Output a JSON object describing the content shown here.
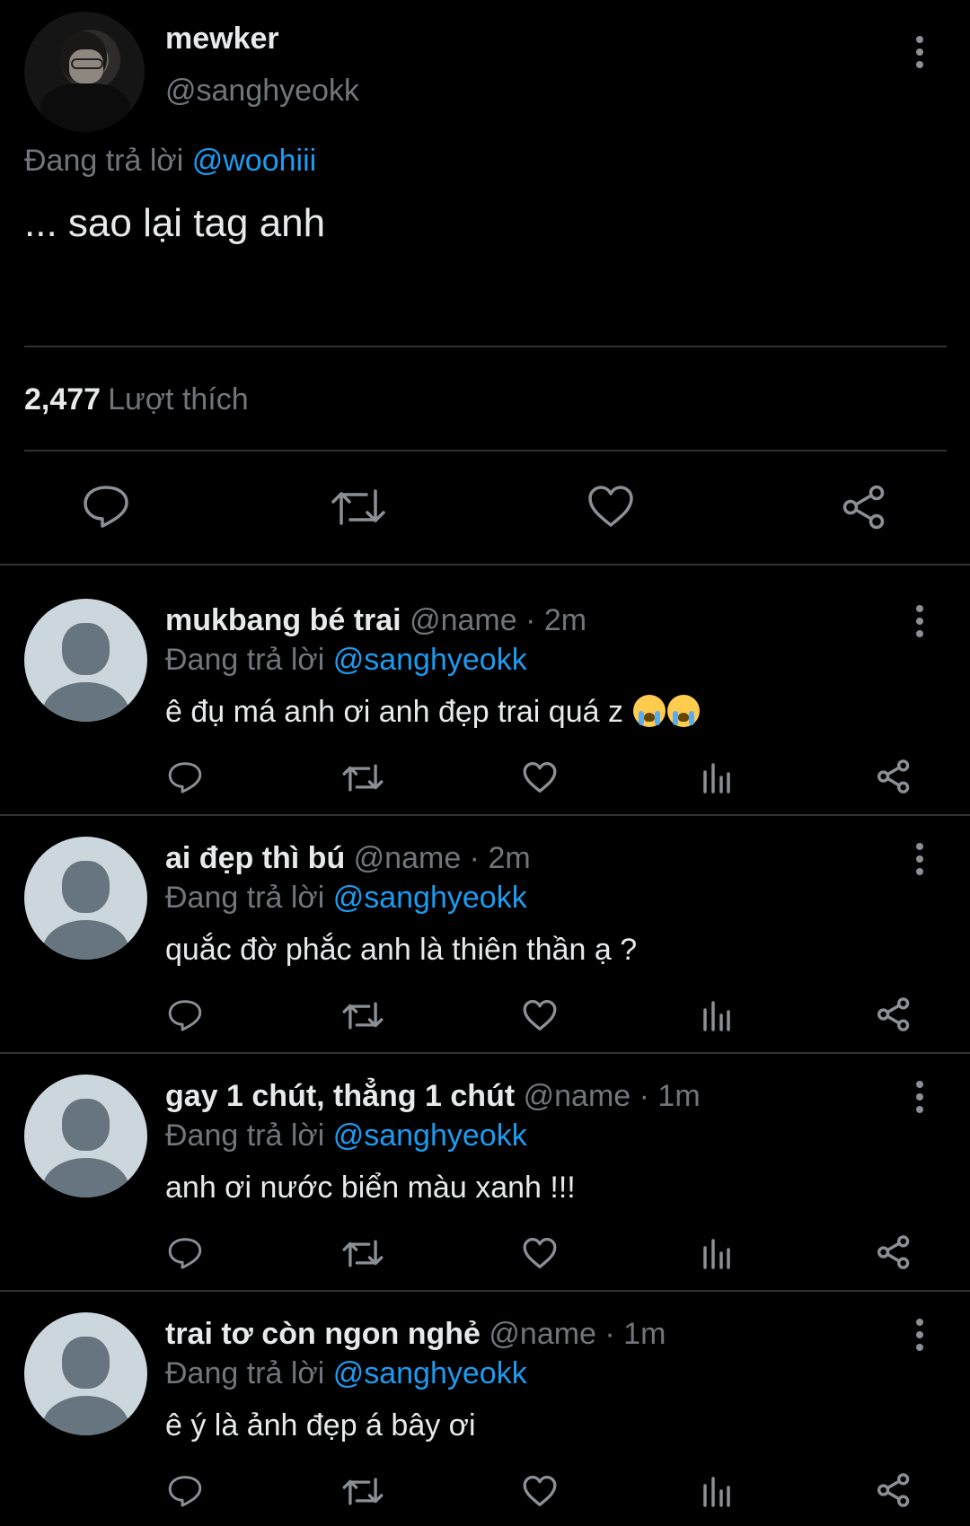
{
  "main_tweet": {
    "author_name": "mewker",
    "author_handle": "@sanghyeokk",
    "reply_prefix": "Đang trả lời",
    "reply_to": "@woohiii",
    "text": "... sao lại tag anh",
    "like_count": "2,477",
    "like_label": "Lượt thích"
  },
  "icons": {
    "reply": "reply-icon",
    "retweet": "retweet-icon",
    "like": "heart-icon",
    "share": "share-icon",
    "stats": "stats-icon",
    "more": "more-vertical-icon"
  },
  "colors": {
    "background": "#000000",
    "text": "#e7e9ea",
    "muted": "#71767b",
    "mention": "#1d9bf0",
    "divider": "#2f3336"
  },
  "replies": [
    {
      "name": "mukbang bé trai",
      "meta": "@name · 2m",
      "reply_prefix": "Đang trả lời",
      "reply_to": "@sanghyeokk",
      "text": "ê đụ má anh ơi anh đẹp trai quá z",
      "emoji": "😭😭"
    },
    {
      "name": "ai đẹp thì bú",
      "meta": "@name · 2m",
      "reply_prefix": "Đang trả lời",
      "reply_to": "@sanghyeokk",
      "text": "quắc đờ phắc anh là thiên thần ạ ?"
    },
    {
      "name": "gay 1 chút, thẳng 1 chút",
      "meta": "@name · 1m",
      "reply_prefix": "Đang trả lời",
      "reply_to": "@sanghyeokk",
      "text": "anh ơi nước biển màu xanh !!!"
    },
    {
      "name": "trai tơ còn ngon nghẻ",
      "meta": "@name · 1m",
      "reply_prefix": "Đang trả lời",
      "reply_to": "@sanghyeokk",
      "text": "ê ý là ảnh đẹp á bây ơi"
    }
  ]
}
